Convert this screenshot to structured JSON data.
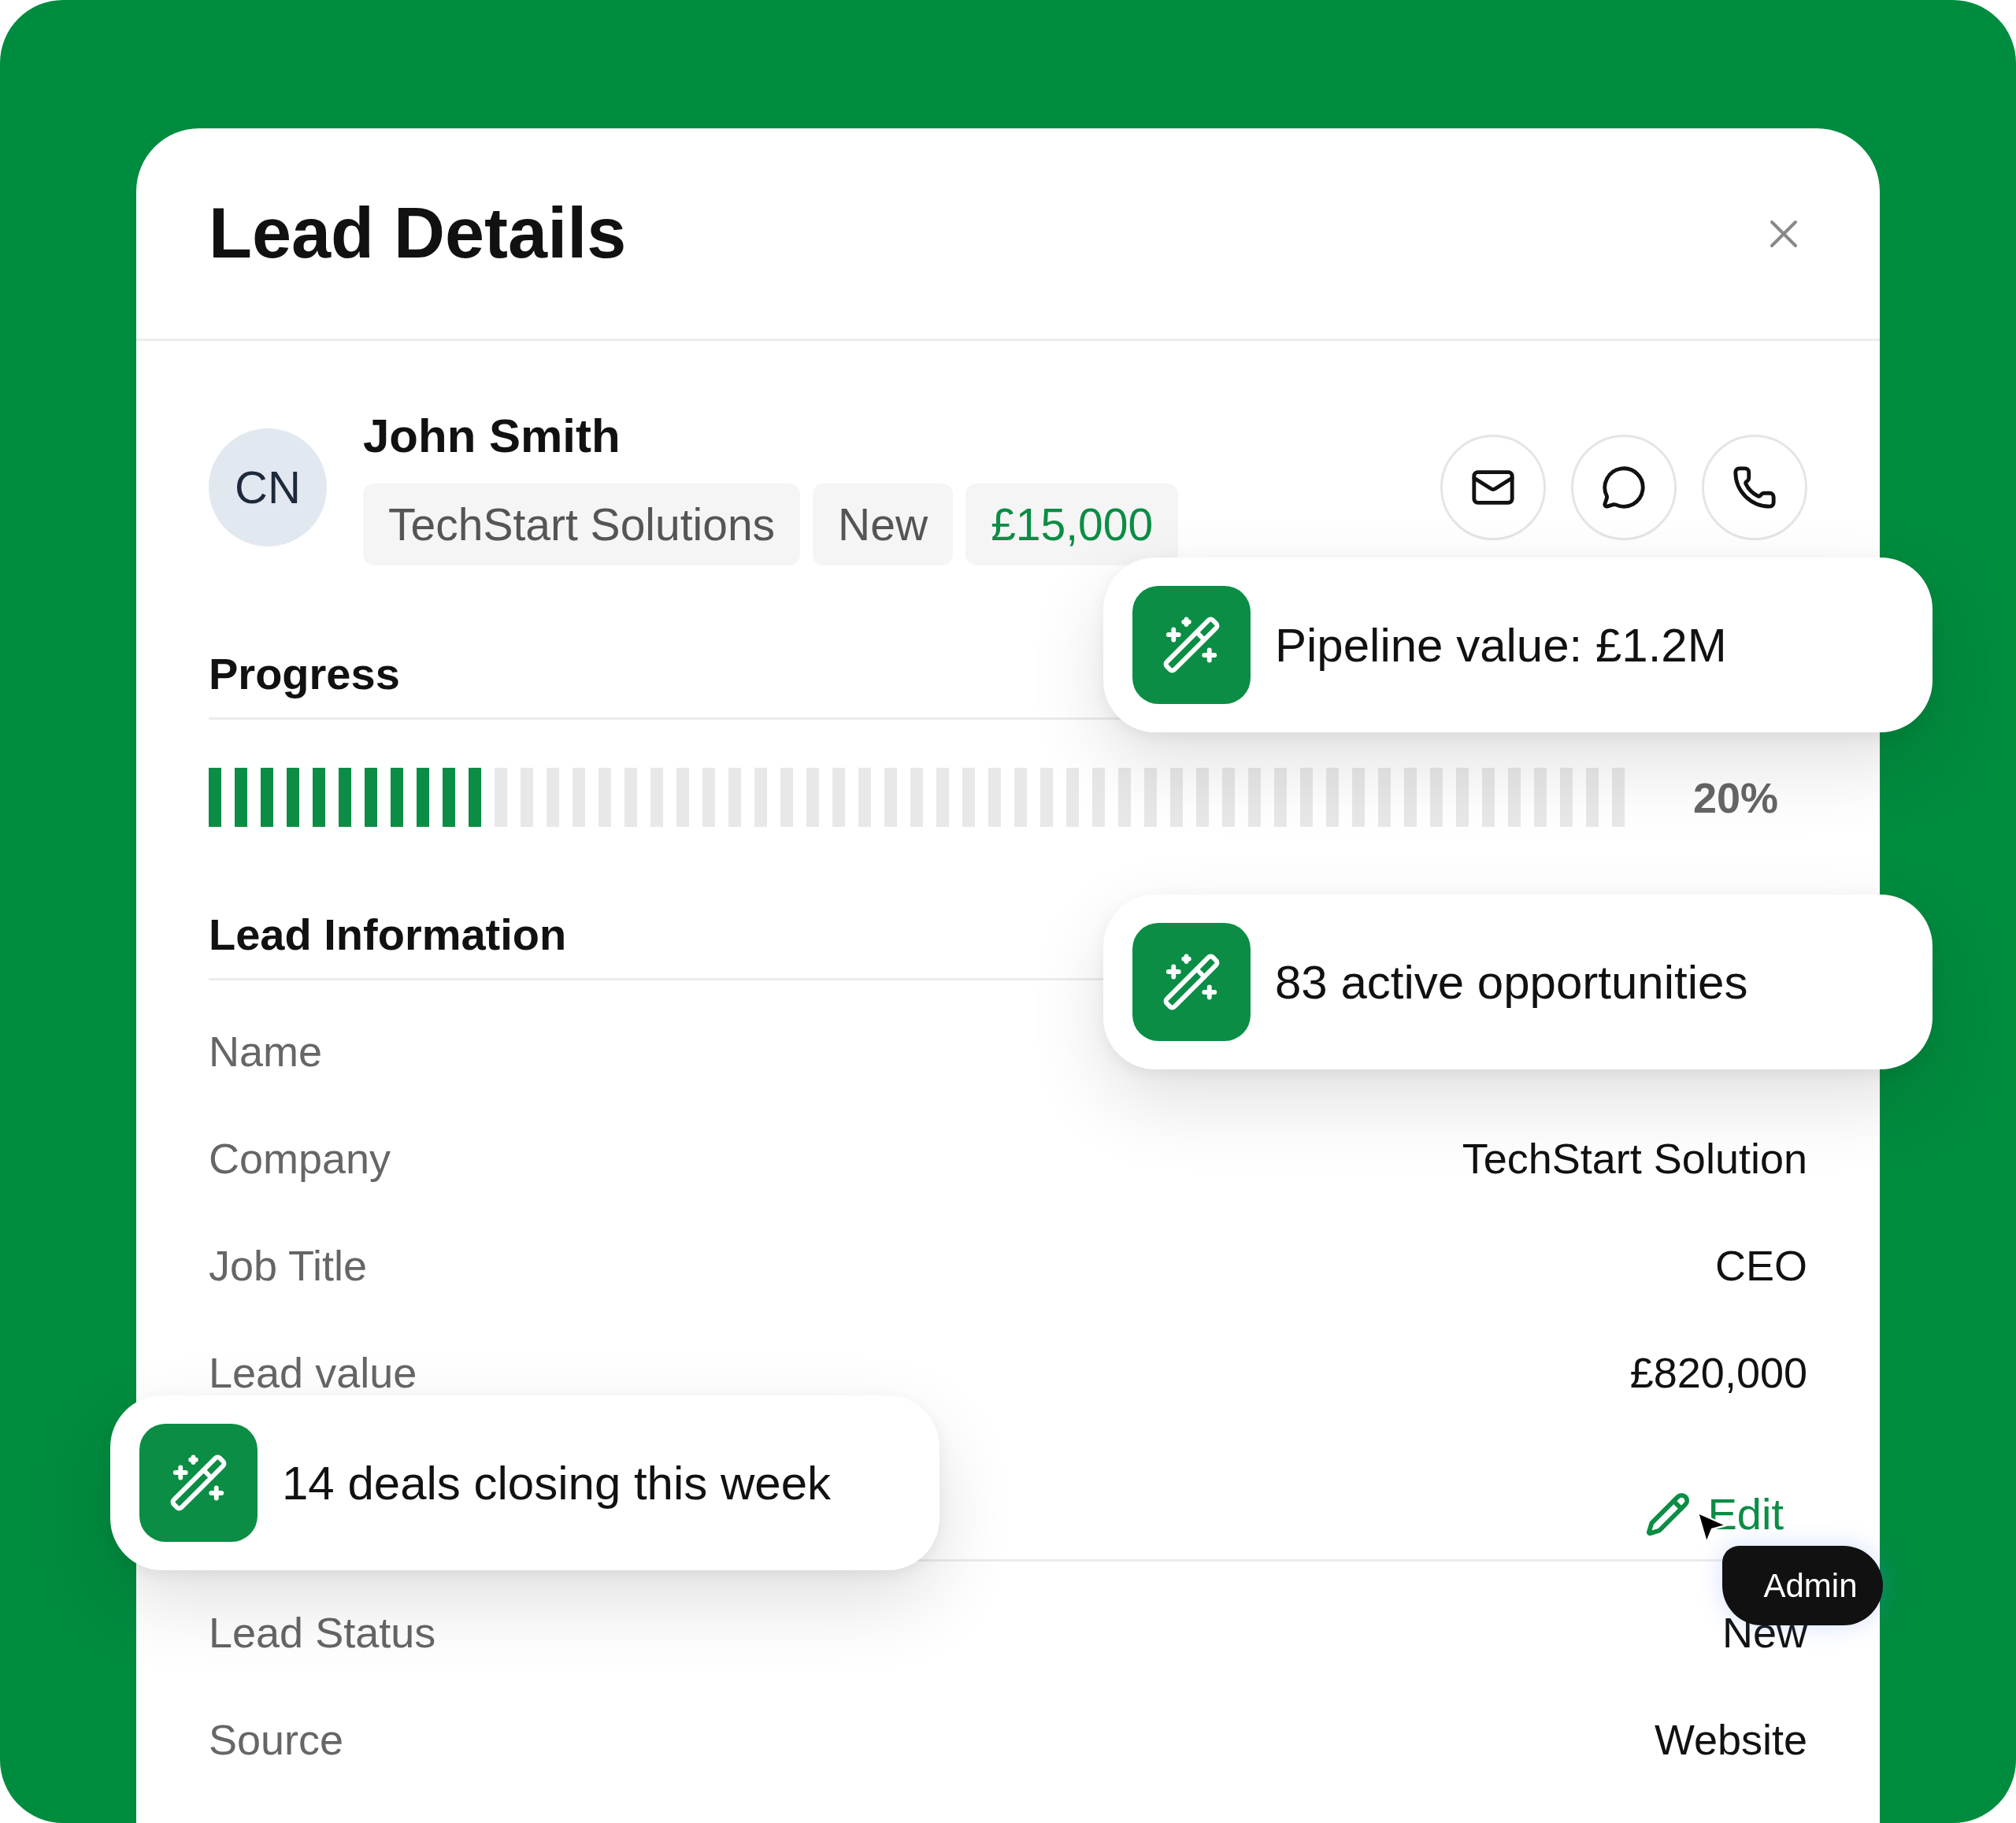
{
  "dialog": {
    "title": "Lead Details"
  },
  "contact": {
    "initials": "CN",
    "name": "John Smith",
    "tags": [
      {
        "label": "TechStart Solutions",
        "kind": "neutral"
      },
      {
        "label": "New",
        "kind": "neutral"
      },
      {
        "label": "£15,000",
        "kind": "value"
      }
    ]
  },
  "actions": [
    {
      "kind": "email"
    },
    {
      "kind": "message"
    },
    {
      "kind": "phone"
    }
  ],
  "progress": {
    "heading": "Progress",
    "level": 0.2,
    "reading": "20%"
  },
  "lead_information": {
    "heading": "Lead Information",
    "fields": [
      {
        "label": "Name"
      },
      {
        "label": "Company",
        "value": "TechStart Solution"
      },
      {
        "label": "Job Title",
        "value": "CEO"
      },
      {
        "label": "Lead value",
        "value": "£820,000"
      }
    ],
    "edit": "Edit",
    "more_fields": [
      {
        "label": "Lead Status",
        "value": "New"
      },
      {
        "label": "Source",
        "value": "Website"
      }
    ]
  },
  "highlights": [
    {
      "text": "Pipeline value: £1.2M"
    },
    {
      "text": "83 active opportunities"
    },
    {
      "text": "14 deals closing this week"
    }
  ],
  "tooltip": {
    "text": "Admin"
  }
}
